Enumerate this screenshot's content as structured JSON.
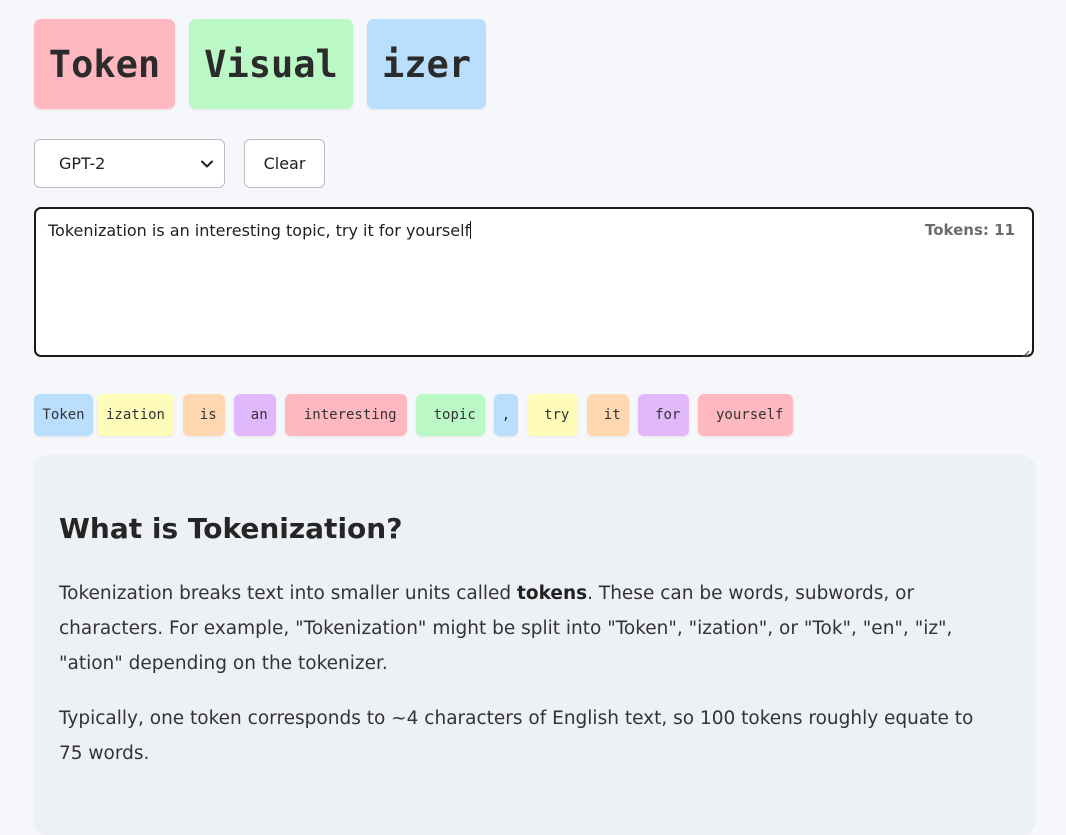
{
  "title_chips": [
    {
      "text": "Token",
      "color": "#ffb8c0"
    },
    {
      "text": "Visual",
      "color": "#baf8c6"
    },
    {
      "text": "izer",
      "color": "#b9defe"
    }
  ],
  "controls": {
    "model_select": {
      "value": "GPT-2",
      "icon": "chevron-down-icon"
    },
    "clear_label": "Clear"
  },
  "editor": {
    "value": "Tokenization is an interesting topic, try it for yourself",
    "token_count_label": "Tokens: 11"
  },
  "tokens": [
    {
      "text": "Token",
      "color": "#b9defe"
    },
    {
      "text": "ization",
      "color": "#fffcba"
    },
    {
      "text": " is",
      "color": "#ffd8b2"
    },
    {
      "text": " an",
      "color": "#e2b8fc"
    },
    {
      "text": " interesting",
      "color": "#ffb8c0"
    },
    {
      "text": " topic",
      "color": "#baf8c6"
    },
    {
      "text": ",",
      "color": "#b9defe"
    },
    {
      "text": " try",
      "color": "#fffcba"
    },
    {
      "text": " it",
      "color": "#ffd8b2"
    },
    {
      "text": " for",
      "color": "#e2b8fc"
    },
    {
      "text": " yourself",
      "color": "#ffb8c0"
    }
  ],
  "info": {
    "heading": "What is Tokenization?",
    "p1_before": "Tokenization breaks text into smaller units called ",
    "p1_bold": "tokens",
    "p1_after": ". These can be words, subwords, or characters. For example, \"Tokenization\" might be split into \"Token\", \"ization\", or \"Tok\", \"en\", \"iz\", \"ation\" depending on the tokenizer.",
    "p2": "Typically, one token corresponds to ~4 characters of English text, so 100 tokens roughly equate to 75 words."
  }
}
